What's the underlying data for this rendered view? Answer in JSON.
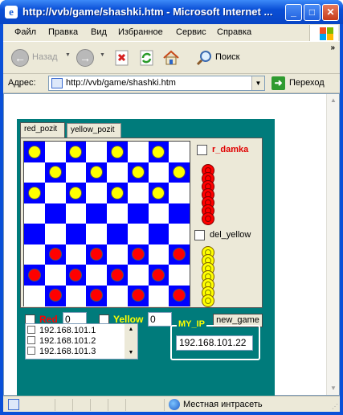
{
  "window": {
    "title": "http://vvb/game/shashki.htm - Microsoft Internet ...",
    "icon": "ie-icon",
    "controls": {
      "minimize": "_",
      "maximize": "□",
      "close": "✕"
    }
  },
  "menu": {
    "items": [
      "Файл",
      "Правка",
      "Вид",
      "Избранное",
      "Сервис",
      "Справка"
    ]
  },
  "toolbar": {
    "back_label": "Назад",
    "search_label": "Поиск",
    "overflow": "»"
  },
  "address": {
    "label": "Адрес:",
    "url": "http://vvb/game/shashki.htm",
    "go_label": "Переход"
  },
  "applet": {
    "tabs": [
      {
        "label": "red_pozit",
        "active": true
      },
      {
        "label": "yellow_pozit",
        "active": false
      }
    ],
    "board_colors": {
      "dark": "#0000ff",
      "light": "#ffffff"
    },
    "yellow_rows": [
      0,
      1,
      2
    ],
    "red_rows": [
      5,
      6,
      7
    ],
    "r_damka_label": "r_damka",
    "del_yellow_label": "del_yellow",
    "red_label": "Red",
    "red_value": "0",
    "yellow_label": "Yellow",
    "yellow_value": "0",
    "new_game_label": "new_game",
    "ip_list": [
      "192.168.101.1",
      "192.168.101.2",
      "192.168.101.3"
    ],
    "my_ip_legend": "MY_IP",
    "my_ip_value": "192.168.101.22",
    "colors": {
      "red": "#ff0000",
      "yellow": "#ffff00",
      "panel_bg": "#007b7b"
    }
  },
  "status": {
    "zone": "Местная интрасеть"
  }
}
